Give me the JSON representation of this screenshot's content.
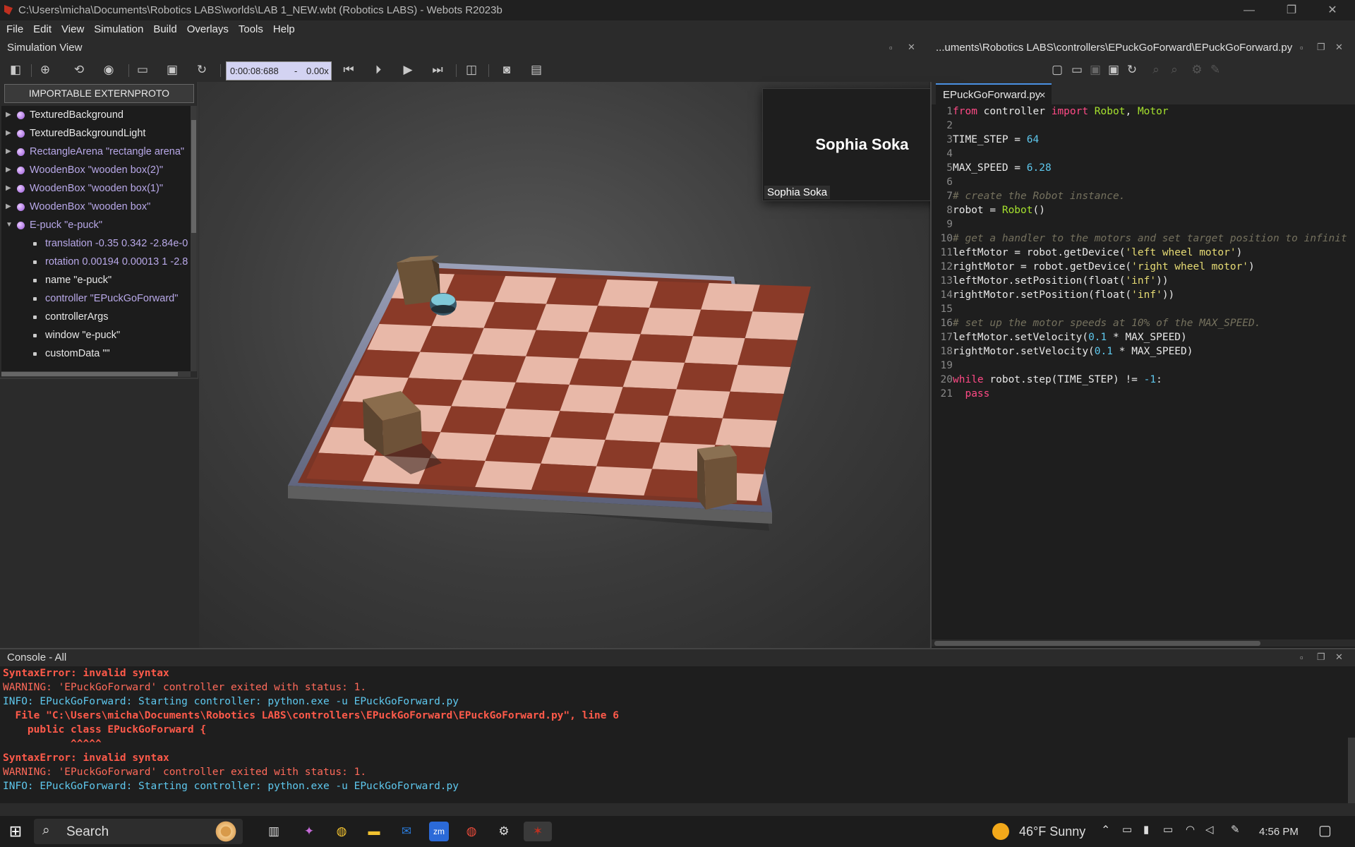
{
  "window": {
    "title": "C:\\Users\\micha\\Documents\\Robotics LABS\\worlds\\LAB 1_NEW.wbt (Robotics LABS) - Webots R2023b",
    "minimize": "—",
    "restore": "❐",
    "close": "✕"
  },
  "menu": [
    "File",
    "Edit",
    "View",
    "Simulation",
    "Build",
    "Overlays",
    "Tools",
    "Help"
  ],
  "sim_view": {
    "title": "Simulation View",
    "time": "0:00:08:688",
    "speed": "-",
    "speed_factor": "0.00x"
  },
  "scene_tree": {
    "importable_button": "IMPORTABLE EXTERNPROTO",
    "nodes": [
      {
        "label": "TexturedBackground",
        "color": "#e8e8e8"
      },
      {
        "label": "TexturedBackgroundLight",
        "color": "#e8e8e8"
      },
      {
        "label": "RectangleArena \"rectangle arena\"",
        "color": "#b8a8e8"
      },
      {
        "label": "WoodenBox \"wooden box(2)\"",
        "color": "#b8a8e8"
      },
      {
        "label": "WoodenBox \"wooden box(1)\"",
        "color": "#b8a8e8"
      },
      {
        "label": "WoodenBox \"wooden box\"",
        "color": "#b8a8e8"
      },
      {
        "label": "E-puck \"e-puck\"",
        "color": "#b8a8e8"
      }
    ],
    "fields": [
      {
        "label": "translation -0.35 0.342 -2.84e-0",
        "color": "#b8a8e8"
      },
      {
        "label": "rotation 0.00194 0.00013 1 -2.8",
        "color": "#b8a8e8"
      },
      {
        "label": "name \"e-puck\"",
        "color": "#e8e8e8"
      },
      {
        "label": "controller \"EPuckGoForward\"",
        "color": "#b8a8e8"
      },
      {
        "label": "controllerArgs",
        "color": "#e8e8e8"
      },
      {
        "label": "window \"e-puck\"",
        "color": "#e8e8e8"
      },
      {
        "label": "customData \"\"",
        "color": "#e8e8e8"
      }
    ]
  },
  "popup": {
    "name_large": "Sophia Soka",
    "name_small": "Sophia Soka"
  },
  "editor": {
    "path": "...uments\\Robotics LABS\\controllers\\EPuckGoForward\\EPuckGoForward.py",
    "tab": "EPuckGoForward.py",
    "tab_close": "✕",
    "lines": [
      [
        {
          "t": "from",
          "c": "kw"
        },
        {
          "t": " controller ",
          "c": ""
        },
        {
          "t": "import",
          "c": "kw"
        },
        {
          "t": " Robot",
          "c": "cls"
        },
        {
          "t": ", ",
          "c": ""
        },
        {
          "t": "Motor",
          "c": "cls"
        }
      ],
      [],
      [
        {
          "t": "TIME_STEP = ",
          "c": ""
        },
        {
          "t": "64",
          "c": "num"
        }
      ],
      [],
      [
        {
          "t": "MAX_SPEED = ",
          "c": ""
        },
        {
          "t": "6.28",
          "c": "num"
        }
      ],
      [],
      [
        {
          "t": "# create the Robot instance.",
          "c": "cm"
        }
      ],
      [
        {
          "t": "robot = ",
          "c": ""
        },
        {
          "t": "Robot",
          "c": "cls"
        },
        {
          "t": "()",
          "c": ""
        }
      ],
      [],
      [
        {
          "t": "# get a handler to the motors and set target position to infinit",
          "c": "cm"
        }
      ],
      [
        {
          "t": "leftMotor = robot.getDevice(",
          "c": ""
        },
        {
          "t": "'left wheel motor'",
          "c": "str"
        },
        {
          "t": ")",
          "c": ""
        }
      ],
      [
        {
          "t": "rightMotor = robot.getDevice(",
          "c": ""
        },
        {
          "t": "'right wheel motor'",
          "c": "str"
        },
        {
          "t": ")",
          "c": ""
        }
      ],
      [
        {
          "t": "leftMotor.setPosition(float(",
          "c": ""
        },
        {
          "t": "'inf'",
          "c": "str"
        },
        {
          "t": "))",
          "c": ""
        }
      ],
      [
        {
          "t": "rightMotor.setPosition(float(",
          "c": ""
        },
        {
          "t": "'inf'",
          "c": "str"
        },
        {
          "t": "))",
          "c": ""
        }
      ],
      [],
      [
        {
          "t": "# set up the motor speeds at 10% of the MAX_SPEED.",
          "c": "cm"
        }
      ],
      [
        {
          "t": "leftMotor.setVelocity(",
          "c": ""
        },
        {
          "t": "0.1",
          "c": "num"
        },
        {
          "t": " * MAX_SPEED)",
          "c": ""
        }
      ],
      [
        {
          "t": "rightMotor.setVelocity(",
          "c": ""
        },
        {
          "t": "0.1",
          "c": "num"
        },
        {
          "t": " * MAX_SPEED)",
          "c": ""
        }
      ],
      [],
      [
        {
          "t": "while",
          "c": "kw"
        },
        {
          "t": " robot.step(TIME_STEP) != ",
          "c": ""
        },
        {
          "t": "-1",
          "c": "num"
        },
        {
          "t": ":",
          "c": ""
        }
      ],
      [
        {
          "t": "  ",
          "c": ""
        },
        {
          "t": "pass",
          "c": "kw"
        }
      ]
    ]
  },
  "console": {
    "title": "Console - All",
    "lines": [
      {
        "t": "SyntaxError: invalid syntax",
        "c": "err"
      },
      {
        "t": "WARNING: 'EPuckGoForward' controller exited with status: 1.",
        "c": "warn"
      },
      {
        "t": "INFO: EPuckGoForward: Starting controller: python.exe -u EPuckGoForward.py",
        "c": "info"
      },
      {
        "t": "  File \"C:\\Users\\micha\\Documents\\Robotics LABS\\controllers\\EPuckGoForward\\EPuckGoForward.py\", line 6",
        "c": "err"
      },
      {
        "t": "    public class EPuckGoForward {",
        "c": "err"
      },
      {
        "t": "           ^^^^^",
        "c": "err"
      },
      {
        "t": "SyntaxError: invalid syntax",
        "c": "err"
      },
      {
        "t": "WARNING: 'EPuckGoForward' controller exited with status: 1.",
        "c": "warn"
      },
      {
        "t": "INFO: EPuckGoForward: Starting controller: python.exe -u EPuckGoForward.py",
        "c": "info"
      }
    ]
  },
  "taskbar": {
    "search": "Search",
    "weather": "46°F  Sunny",
    "time": "4:56 PM"
  }
}
